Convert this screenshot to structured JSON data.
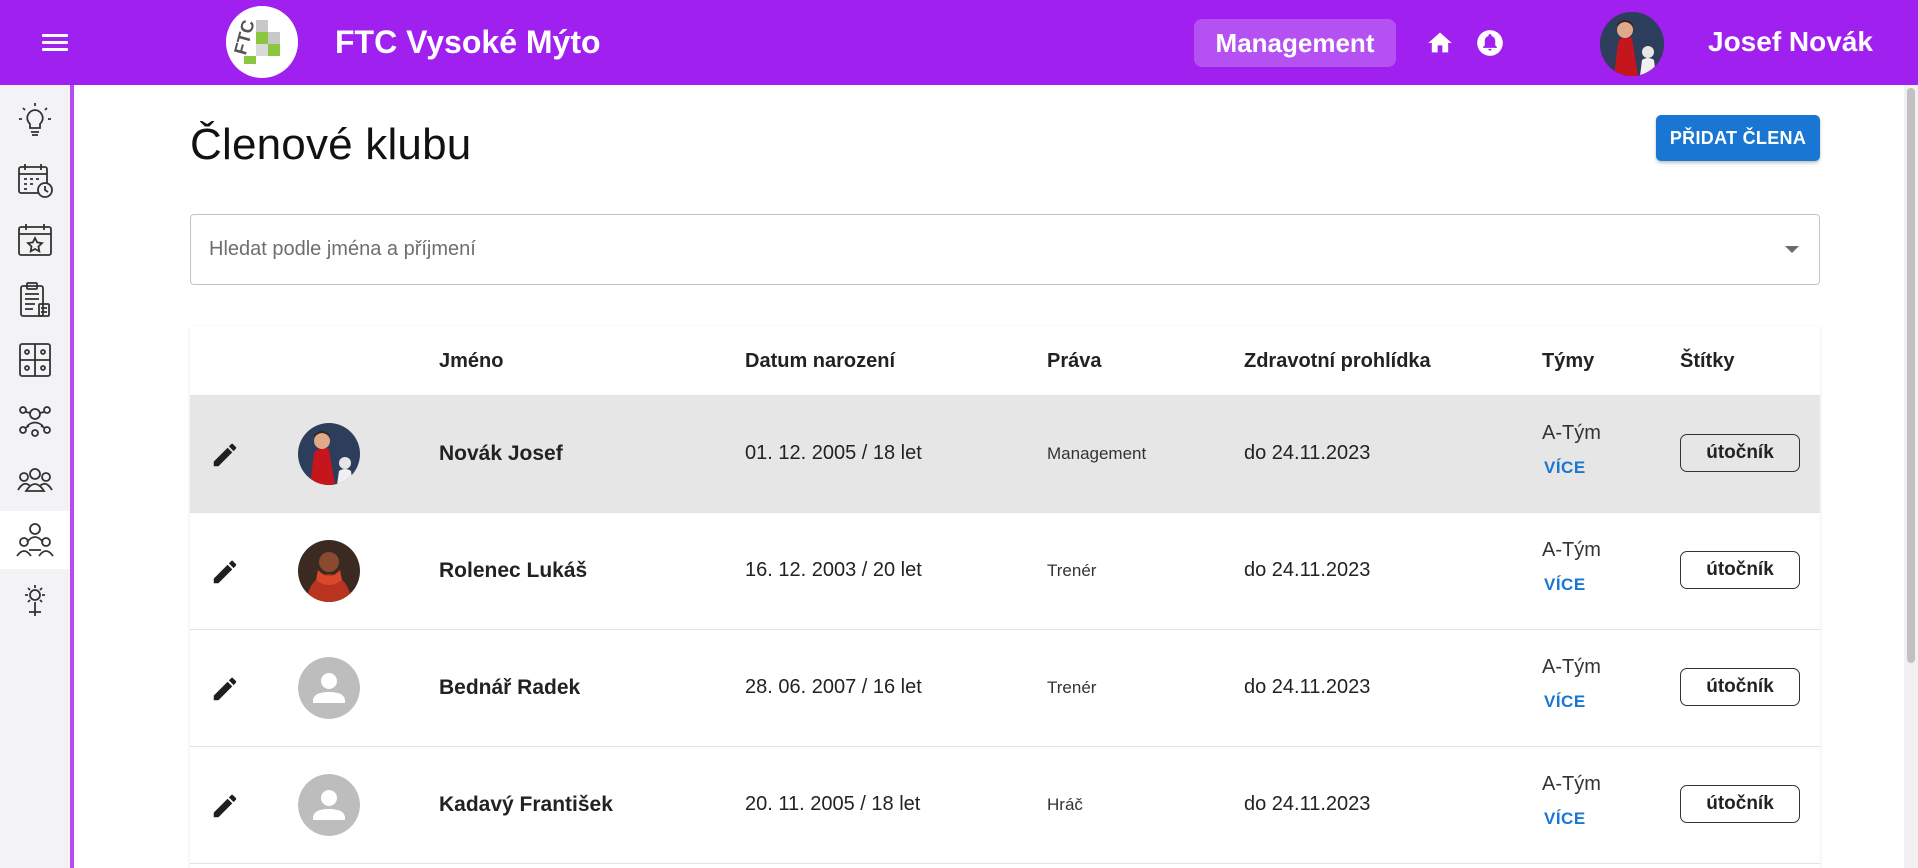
{
  "header": {
    "brand": "FTC Vysoké Mýto",
    "logo_text": "FTC Vysoké mýto",
    "role_chip": "Management",
    "user_name": "Josef Novák",
    "accent_color": "#a020f0"
  },
  "sidebar": {
    "items": [
      {
        "icon": "lightbulb-icon"
      },
      {
        "icon": "calendar-clock-icon"
      },
      {
        "icon": "calendar-star-icon"
      },
      {
        "icon": "clipboard-list-icon"
      },
      {
        "icon": "tactics-board-icon"
      },
      {
        "icon": "network-people-icon"
      },
      {
        "icon": "group-icon"
      },
      {
        "icon": "members-icon",
        "active": true
      },
      {
        "icon": "gear-tree-icon"
      }
    ]
  },
  "page": {
    "title": "Členové klubu",
    "add_button": "PŘIDAT ČLENA",
    "search_placeholder": "Hledat podle jména a příjmení"
  },
  "table": {
    "headers": {
      "name": "Jméno",
      "dob": "Datum narození",
      "rights": "Práva",
      "health": "Zdravotní prohlídka",
      "teams": "Týmy",
      "tags": "Štítky"
    },
    "rows": [
      {
        "name": "Novák Josef",
        "dob": "01. 12. 2005 / 18 let",
        "rights": "Management",
        "health": "do 24.11.2023",
        "team": "A-Tým",
        "more": "VÍCE",
        "tag": "útočník",
        "avatar": "photo-red-jersey"
      },
      {
        "name": "Rolenec Lukáš",
        "dob": "16. 12. 2003 / 20 let",
        "rights": "Trenér",
        "health": "do 24.11.2023",
        "team": "A-Tým",
        "more": "VÍCE",
        "tag": "útočník",
        "avatar": "photo-dark"
      },
      {
        "name": "Bednář Radek",
        "dob": "28. 06. 2007 / 16 let",
        "rights": "Trenér",
        "health": "do 24.11.2023",
        "team": "A-Tým",
        "more": "VÍCE",
        "tag": "útočník",
        "avatar": "default-person"
      },
      {
        "name": "Kadavý František",
        "dob": "20. 11. 2005 / 18 let",
        "rights": "Hráč",
        "health": "do 24.11.2023",
        "team": "A-Tým",
        "more": "VÍCE",
        "tag": "útočník",
        "avatar": "default-person"
      }
    ]
  }
}
